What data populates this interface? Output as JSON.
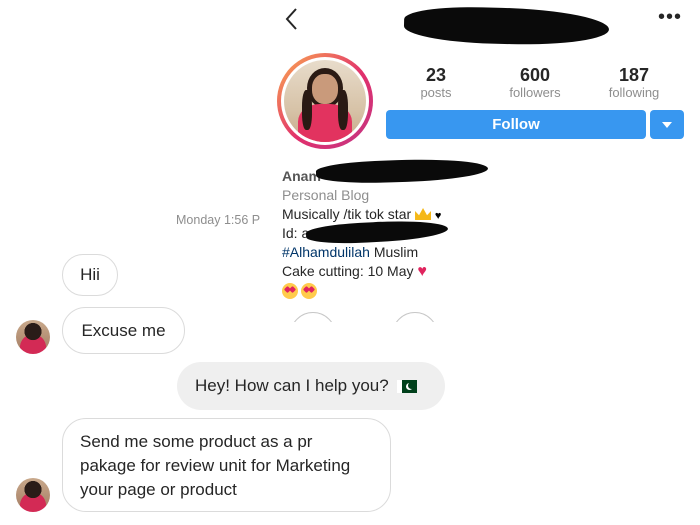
{
  "chat": {
    "timestamp": "Monday 1:56 P",
    "messages": [
      {
        "sender": "them",
        "text": "Hii"
      },
      {
        "sender": "them",
        "text": "Excuse me"
      },
      {
        "sender": "me",
        "text": "Hey! How can I help you?"
      },
      {
        "sender": "them",
        "text_lines": [
          "Send me some product as a pr",
          "pakage for review unit for Marketing",
          "your page or product"
        ]
      }
    ]
  },
  "profile": {
    "stats": [
      {
        "value": "23",
        "label": "posts"
      },
      {
        "value": "600",
        "label": "followers"
      },
      {
        "value": "187",
        "label": "following"
      }
    ],
    "follow_label": "Follow",
    "bio": {
      "name_visible": "Anam",
      "category": "Personal Blog",
      "line1": "Musically /tik tok star",
      "line2": "Id: an",
      "hashtag": "#Alhamdulilah",
      "line3_rest": " Muslim",
      "line4": "Cake cutting: 10 May"
    }
  },
  "colors": {
    "accent": "#3897f0",
    "bubble_out": "#efefef",
    "muted": "#8e8e8e"
  },
  "icons": [
    "back-arrow-icon",
    "more-options-icon",
    "chevron-down-icon",
    "crown-emoji",
    "black-heart-emoji",
    "red-heart-emoji",
    "heart-eyes-emoji",
    "pakistan-flag-emoji"
  ]
}
